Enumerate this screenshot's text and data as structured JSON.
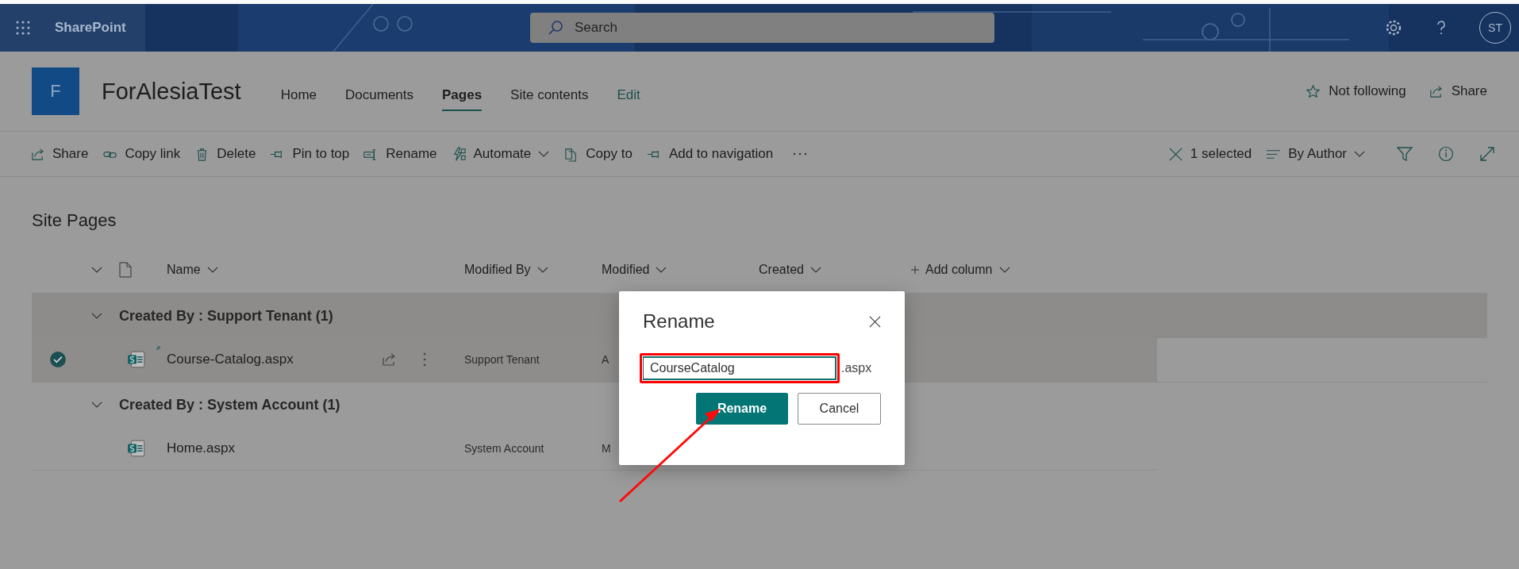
{
  "suite_bar": {
    "app_name": "SharePoint",
    "search": {
      "placeholder": "Search"
    },
    "avatar": "ST"
  },
  "site_header": {
    "logo_letter": "F",
    "title": "ForAlesiaTest",
    "nav": [
      {
        "label": "Home",
        "selected": false,
        "kind": "link"
      },
      {
        "label": "Documents",
        "selected": false,
        "kind": "link"
      },
      {
        "label": "Pages",
        "selected": true,
        "kind": "link"
      },
      {
        "label": "Site contents",
        "selected": false,
        "kind": "link"
      },
      {
        "label": "Edit",
        "selected": false,
        "kind": "edit"
      }
    ],
    "actions": [
      {
        "label": "Not following"
      },
      {
        "label": "Share"
      }
    ]
  },
  "command_bar": {
    "commands": [
      {
        "label": "Share",
        "menu": false
      },
      {
        "label": "Copy link",
        "menu": false
      },
      {
        "label": "Delete",
        "menu": false
      },
      {
        "label": "Pin to top",
        "menu": false
      },
      {
        "label": "Rename",
        "menu": false
      },
      {
        "label": "Automate",
        "menu": true
      },
      {
        "label": "Copy to",
        "menu": false
      },
      {
        "label": "Add to navigation",
        "menu": false
      }
    ],
    "selection": "1 selected",
    "view": "By Author"
  },
  "list": {
    "title": "Site Pages",
    "columns": [
      {
        "label": "Name",
        "kind": "sort"
      },
      {
        "label": "Modified By",
        "kind": "sort"
      },
      {
        "label": "Modified",
        "kind": "sort"
      },
      {
        "label": "Created",
        "kind": "sort"
      },
      {
        "label": "Add column",
        "kind": "add"
      }
    ],
    "groups": [
      {
        "label": "Created By : Support Tenant (1)",
        "expanded": true,
        "rows": [
          {
            "name": "Course-Catalog.aspx",
            "modified_by": "Support Tenant",
            "modified": "A",
            "selected": true,
            "new": true
          }
        ]
      },
      {
        "label": "Created By : System Account (1)",
        "expanded": true,
        "rows": [
          {
            "name": "Home.aspx",
            "modified_by": "System Account",
            "modified": "M",
            "selected": false,
            "new": false
          }
        ]
      }
    ]
  },
  "dialog": {
    "title": "Rename",
    "value": "CourseCatalog",
    "suffix": ".aspx",
    "buttons": [
      {
        "label": "Rename",
        "kind": "primary"
      },
      {
        "label": "Cancel",
        "kind": "secondary"
      }
    ]
  }
}
